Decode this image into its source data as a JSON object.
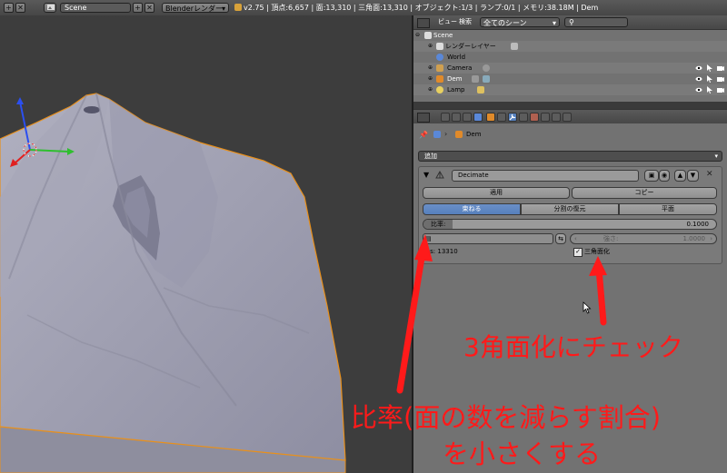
{
  "topbar": {
    "scene_label": "Scene",
    "renderer": "Blenderレンダー",
    "stats": "v2.75 | 頂点:6,657 | 面:13,310 | 三角面:13,310 | オブジェクト:1/3 | ランプ:0/1 | メモリ:38.18M | Dem",
    "plus": "+",
    "close": "✕"
  },
  "outliner": {
    "view_menu": "ビュー",
    "search_menu": "検索",
    "display_mode": "全てのシーン",
    "search_placeholder": "",
    "items": [
      {
        "label": "Scene"
      },
      {
        "label": "レンダーレイヤー"
      },
      {
        "label": "World"
      },
      {
        "label": "Camera"
      },
      {
        "label": "Dem"
      },
      {
        "label": "Lamp"
      }
    ]
  },
  "properties": {
    "breadcrumb_object": "Dem",
    "add_modifier": "追加",
    "modifier_name": "Decimate",
    "apply": "適用",
    "copy": "コピー",
    "tabs": [
      "束ねる",
      "分割の復元",
      "平面"
    ],
    "ratio_label": "比率:",
    "ratio_value": "0.1000",
    "strength_label": "強さ:",
    "strength_value": "1.0000",
    "face_count": "ces: 13310",
    "triangulate_label": "三角面化",
    "triangulate_checked": true
  },
  "annotations": {
    "triangulate_note": "3角面化にチェック",
    "ratio_note_line1": "比率(面の数を減らす割合)",
    "ratio_note_line2": "を小さくする"
  },
  "colors": {
    "accent_blue": "#5680bd",
    "annotation_red": "#ff1a1a",
    "terrain": "#9c9cae",
    "selection_outline": "#e8901c"
  }
}
